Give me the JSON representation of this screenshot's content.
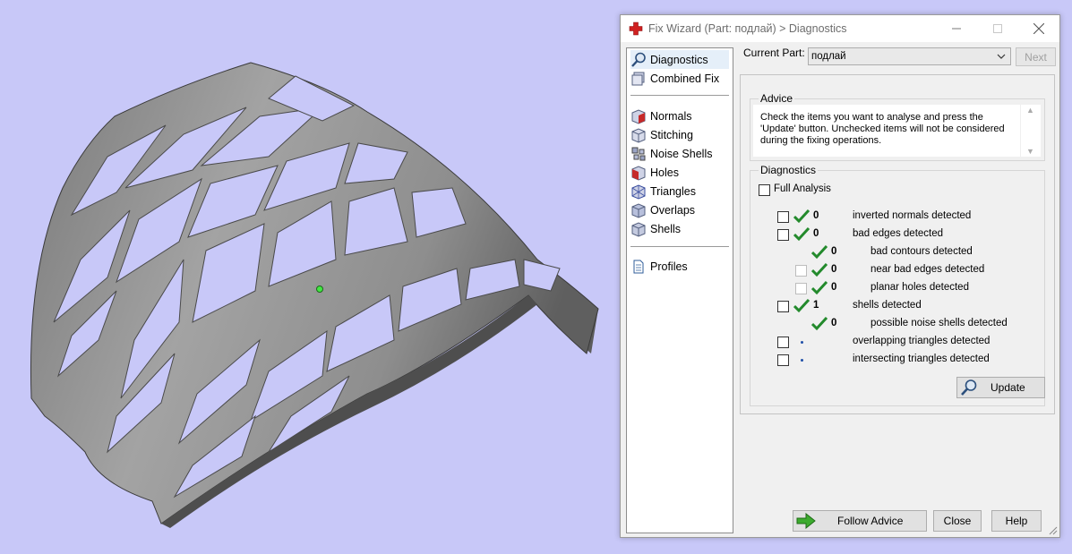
{
  "colors": {
    "viewport_background": "#c8c8f8",
    "model_gray": "#8a8a8a",
    "check_green": "#238a2c",
    "accent_red": "#d02020",
    "follow_arrow_green": "#3cab2e"
  },
  "window": {
    "title": "Fix Wizard (Part: подлай) > Diagnostics",
    "icons": [
      "red-cross-icon",
      "minimize-icon",
      "maximize-icon",
      "close-icon"
    ]
  },
  "sidebar": {
    "items_top": [
      {
        "label": "Diagnostics",
        "icon": "magnifier-icon",
        "selected": true
      },
      {
        "label": "Combined Fix",
        "icon": "cube-stack-icon"
      }
    ],
    "items_fix": [
      {
        "label": "Normals",
        "icon": "normals-cube-icon"
      },
      {
        "label": "Stitching",
        "icon": "stitching-cube-icon"
      },
      {
        "label": "Noise Shells",
        "icon": "noise-shells-icon"
      },
      {
        "label": "Holes",
        "icon": "holes-cube-icon"
      },
      {
        "label": "Triangles",
        "icon": "triangles-cube-icon"
      },
      {
        "label": "Overlaps",
        "icon": "overlaps-cube-icon"
      },
      {
        "label": "Shells",
        "icon": "shells-cube-icon"
      }
    ],
    "items_bottom": [
      {
        "label": "Profiles",
        "icon": "document-icon"
      }
    ]
  },
  "part": {
    "label": "Current Part:",
    "value": "подлай",
    "next_label": "Next"
  },
  "advice": {
    "title": "Advice",
    "text": "Check the items you want to analyse and press the 'Update' button. Unchecked items will not be considered during the fixing operations."
  },
  "diagnostics": {
    "title": "Diagnostics",
    "full_analysis_label": "Full Analysis",
    "rows": [
      {
        "label": "inverted normals detected",
        "count": "0",
        "status": "ok",
        "indent": 0,
        "checkbox": true
      },
      {
        "label": "bad edges detected",
        "count": "0",
        "status": "ok",
        "indent": 0,
        "checkbox": true
      },
      {
        "label": "bad contours detected",
        "count": "0",
        "status": "ok",
        "indent": 1,
        "checkbox": false
      },
      {
        "label": "near bad edges detected",
        "count": "0",
        "status": "ok",
        "indent": 1,
        "checkbox": true
      },
      {
        "label": "planar holes detected",
        "count": "0",
        "status": "ok",
        "indent": 1,
        "checkbox": true
      },
      {
        "label": "shells detected",
        "count": "1",
        "status": "ok",
        "indent": 0,
        "checkbox": true
      },
      {
        "label": "possible noise shells detected",
        "count": "0",
        "status": "ok",
        "indent": 1,
        "checkbox": false
      },
      {
        "label": "overlapping triangles detected",
        "count": "",
        "status": "pending",
        "indent": 0,
        "checkbox": true
      },
      {
        "label": "intersecting triangles detected",
        "count": "",
        "status": "pending",
        "indent": 0,
        "checkbox": true
      }
    ],
    "update_label": "Update"
  },
  "buttons": {
    "follow_advice": "Follow Advice",
    "close": "Close",
    "help": "Help"
  }
}
